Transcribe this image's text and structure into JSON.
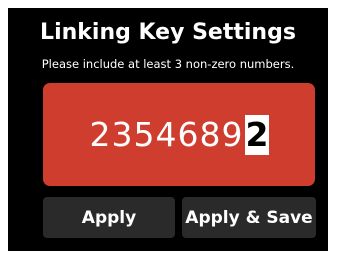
{
  "header": {
    "title": "Linking Key Settings",
    "instruction": "Please include at least 3 non-zero numbers."
  },
  "key": {
    "digits": [
      "2",
      "3",
      "5",
      "4",
      "6",
      "8",
      "9",
      "2"
    ],
    "selected_index": 7
  },
  "buttons": {
    "apply_label": "Apply",
    "apply_save_label": "Apply & Save"
  },
  "colors": {
    "background": "#000000",
    "key_box": "#cf3d2e",
    "button": "#2a2a2a",
    "selected_digit_bg": "#ffffff"
  }
}
